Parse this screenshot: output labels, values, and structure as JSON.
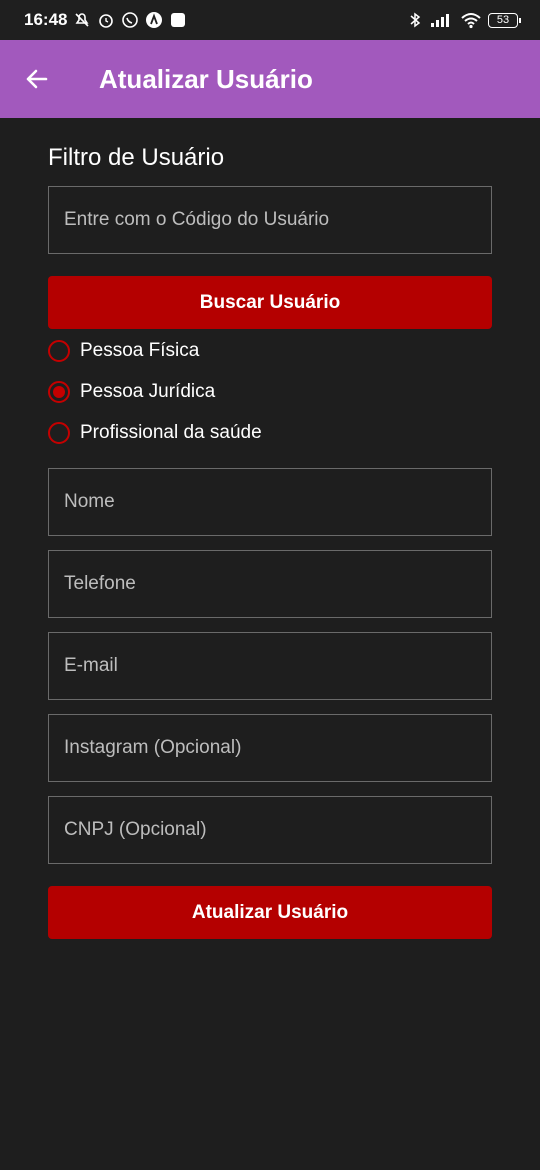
{
  "status_bar": {
    "time": "16:48",
    "battery": "53",
    "left_icons": [
      "mute-icon",
      "alarm-icon",
      "whatsapp-icon",
      "app-icon",
      "square-icon"
    ],
    "right_icons": [
      "bluetooth-icon",
      "signal-icon",
      "wifi-icon",
      "battery-icon"
    ]
  },
  "appbar": {
    "title": "Atualizar Usuário",
    "color": "#a259bd"
  },
  "filter": {
    "title": "Filtro de Usuário",
    "code_placeholder": "Entre com o Código do Usuário",
    "search_button": "Buscar Usuário"
  },
  "person_type": {
    "options": [
      {
        "label": "Pessoa Física",
        "selected": false
      },
      {
        "label": "Pessoa Jurídica",
        "selected": true
      },
      {
        "label": "Profissional da saúde",
        "selected": false
      }
    ]
  },
  "form": {
    "name_placeholder": "Nome",
    "phone_placeholder": "Telefone",
    "email_placeholder": "E-mail",
    "instagram_placeholder": "Instagram (Opcional)",
    "cnpj_placeholder": "CNPJ (Opcional)",
    "submit_button": "Atualizar Usuário"
  },
  "colors": {
    "accent": "#b40000",
    "background": "#1e1e1e"
  }
}
